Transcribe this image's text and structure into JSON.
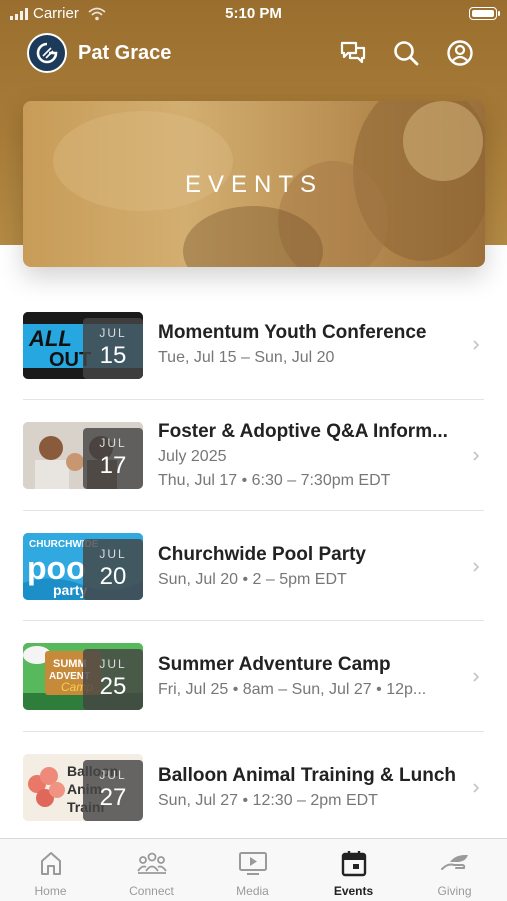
{
  "status": {
    "carrier": "Carrier",
    "time": "5:10 PM"
  },
  "header": {
    "user_name": "Pat Grace"
  },
  "hero": {
    "title": "EVENTS"
  },
  "events": [
    {
      "title": "Momentum Youth Conference",
      "lines": [
        "Tue, Jul 15 – Sun, Jul 20"
      ],
      "month": "JUL",
      "day": "15",
      "thumb_text": "ALL OUT"
    },
    {
      "title": "Foster & Adoptive Q&A Inform...",
      "lines": [
        "July 2025",
        "Thu, Jul 17 • 6:30 – 7:30pm EDT"
      ],
      "month": "JUL",
      "day": "17",
      "thumb_text": ""
    },
    {
      "title": "Churchwide Pool Party",
      "lines": [
        "Sun, Jul 20 • 2 – 5pm EDT"
      ],
      "month": "JUL",
      "day": "20",
      "thumb_text": "CHURCHWIDE pool party"
    },
    {
      "title": "Summer Adventure Camp",
      "lines": [
        "Fri, Jul 25 • 8am – Sun, Jul 27 • 12p..."
      ],
      "month": "JUL",
      "day": "25",
      "thumb_text": "SUMMER ADVENTURE Camp"
    },
    {
      "title": "Balloon Animal Training & Lunch",
      "lines": [
        "Sun, Jul 27 • 12:30 – 2pm EDT"
      ],
      "month": "JUL",
      "day": "27",
      "thumb_text": "Balloon Animal Training"
    }
  ],
  "tabs": [
    {
      "label": "Home",
      "icon": "home-icon",
      "active": false
    },
    {
      "label": "Connect",
      "icon": "people-icon",
      "active": false
    },
    {
      "label": "Media",
      "icon": "play-screen-icon",
      "active": false
    },
    {
      "label": "Events",
      "icon": "calendar-icon",
      "active": true
    },
    {
      "label": "Giving",
      "icon": "giving-hand-icon",
      "active": false
    }
  ],
  "colors": {
    "header_brown": "#a87c38",
    "accent_dark": "#222222",
    "muted": "#777777"
  }
}
